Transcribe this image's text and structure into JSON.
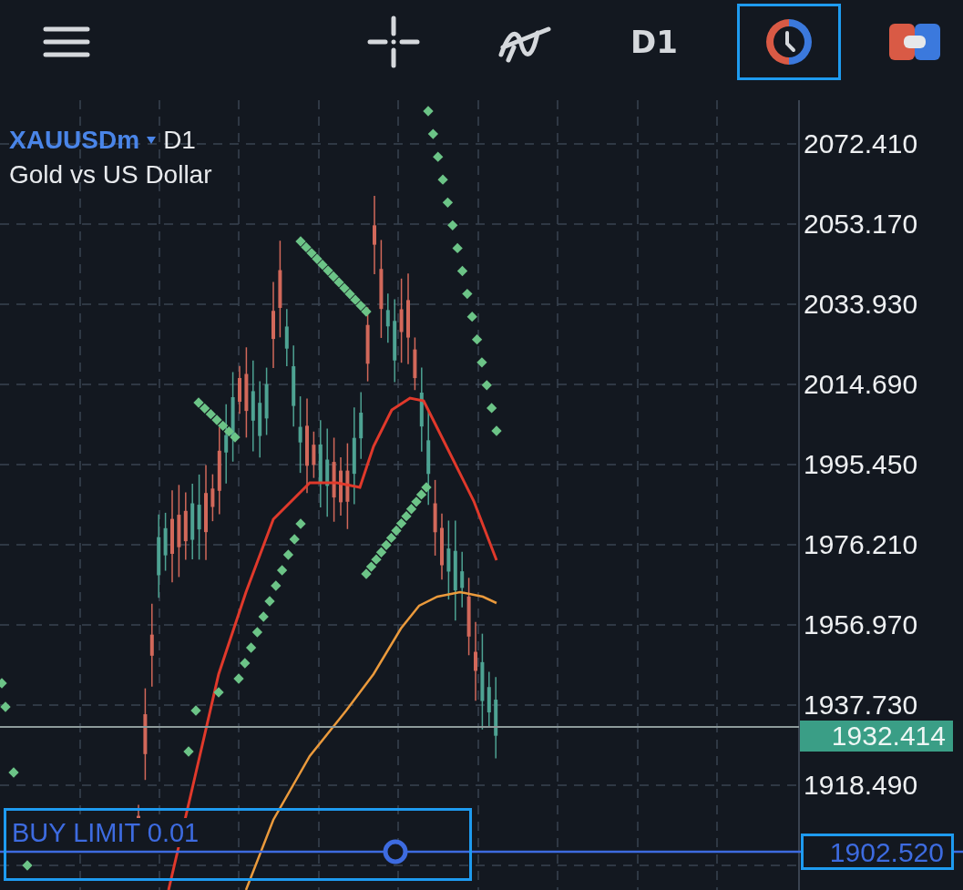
{
  "toolbar": {
    "buttons": [
      {
        "kind": "menu",
        "selected": false
      },
      {
        "kind": "crosshair",
        "selected": false
      },
      {
        "kind": "indicators",
        "selected": false
      },
      {
        "kind": "timeframe",
        "label": "D1",
        "selected": false
      },
      {
        "kind": "clock",
        "selected": true
      },
      {
        "kind": "trade",
        "selected": false
      }
    ]
  },
  "symbol": {
    "ticker": "XAUUSDm",
    "timeframe": "D1",
    "description": "Gold vs US Dollar"
  },
  "price_axis": {
    "labels": [
      "2072.410",
      "2053.170",
      "2033.930",
      "2014.690",
      "1995.450",
      "1976.210",
      "1956.970",
      "1937.730",
      "1918.490"
    ]
  },
  "current_price": "1932.414",
  "pending_order": {
    "label": "BUY LIMIT 0.01",
    "price": "1902.520"
  }
}
